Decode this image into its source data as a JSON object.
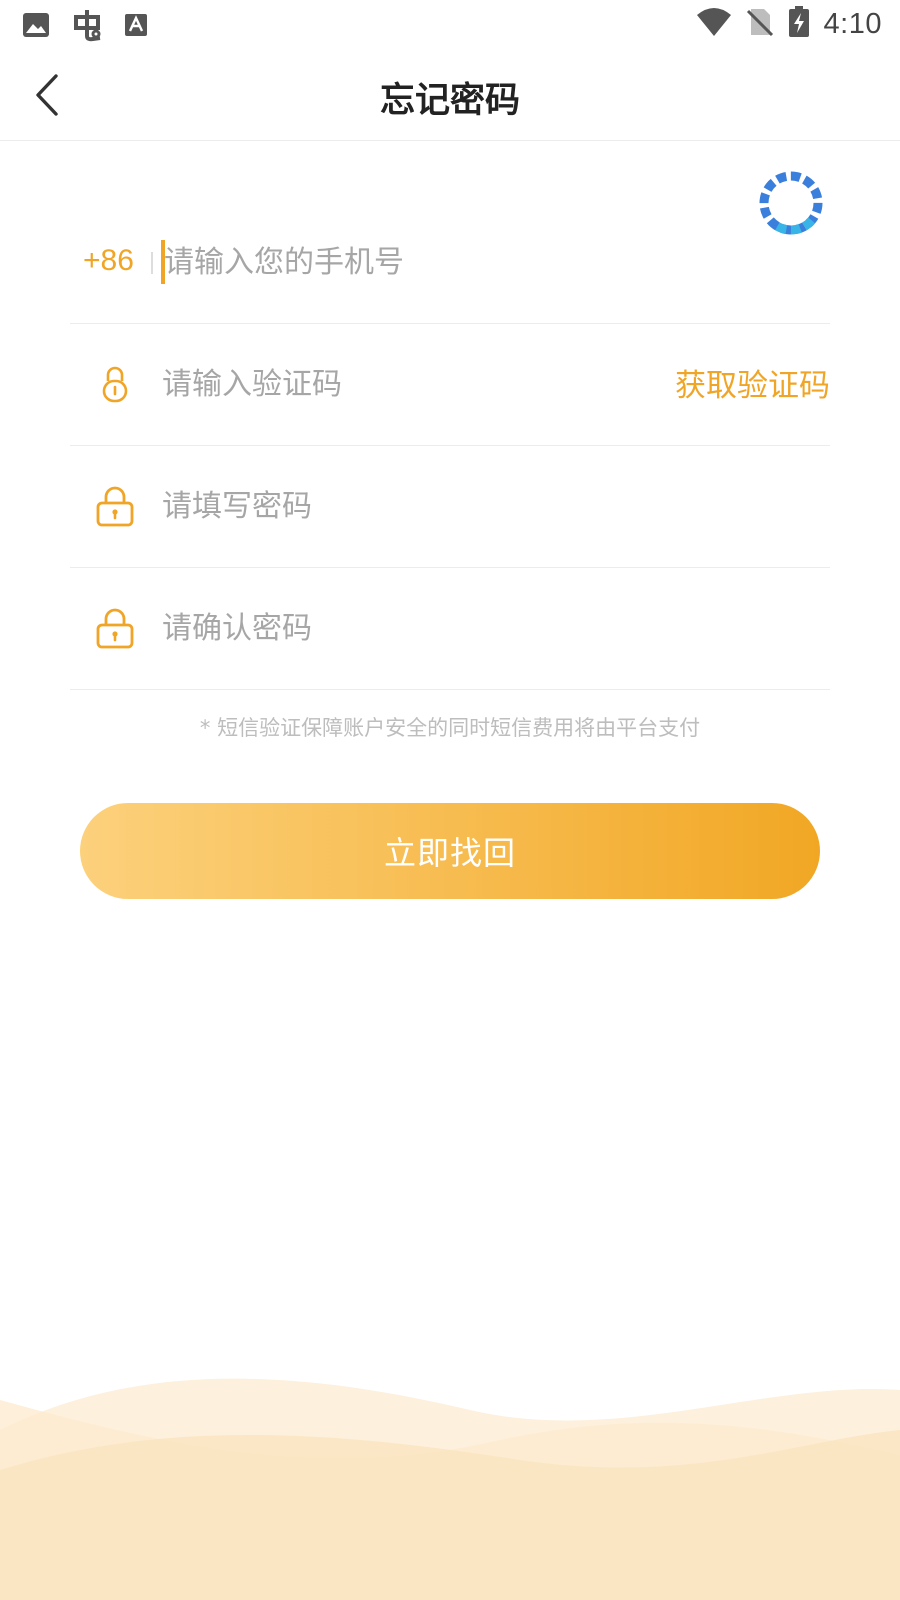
{
  "status_bar": {
    "time": "4:10",
    "left_icons": [
      "image-icon",
      "bug-icon",
      "text-a-icon"
    ],
    "right_icons": [
      "wifi-icon",
      "no-sim-icon",
      "battery-charging-icon"
    ]
  },
  "header": {
    "title": "忘记密码",
    "back_icon": "chevron-left-icon"
  },
  "form": {
    "phone": {
      "country_code": "+86",
      "placeholder": "请输入您的手机号",
      "value": ""
    },
    "code": {
      "placeholder": "请输入验证码",
      "value": "",
      "get_code_label": "获取验证码",
      "icon": "lock-small-icon"
    },
    "password": {
      "placeholder": "请填写密码",
      "value": "",
      "icon": "lock-icon"
    },
    "confirm_password": {
      "placeholder": "请确认密码",
      "value": "",
      "icon": "lock-icon"
    }
  },
  "hint": "* 短信验证保障账户安全的同时短信费用将由平台支付",
  "submit_label": "立即找回",
  "colors": {
    "accent": "#f0a526",
    "gradient_start": "#fcd17c",
    "gradient_end": "#f1a724",
    "spinner": "#3b8ee0",
    "placeholder": "#a6a6a6"
  }
}
